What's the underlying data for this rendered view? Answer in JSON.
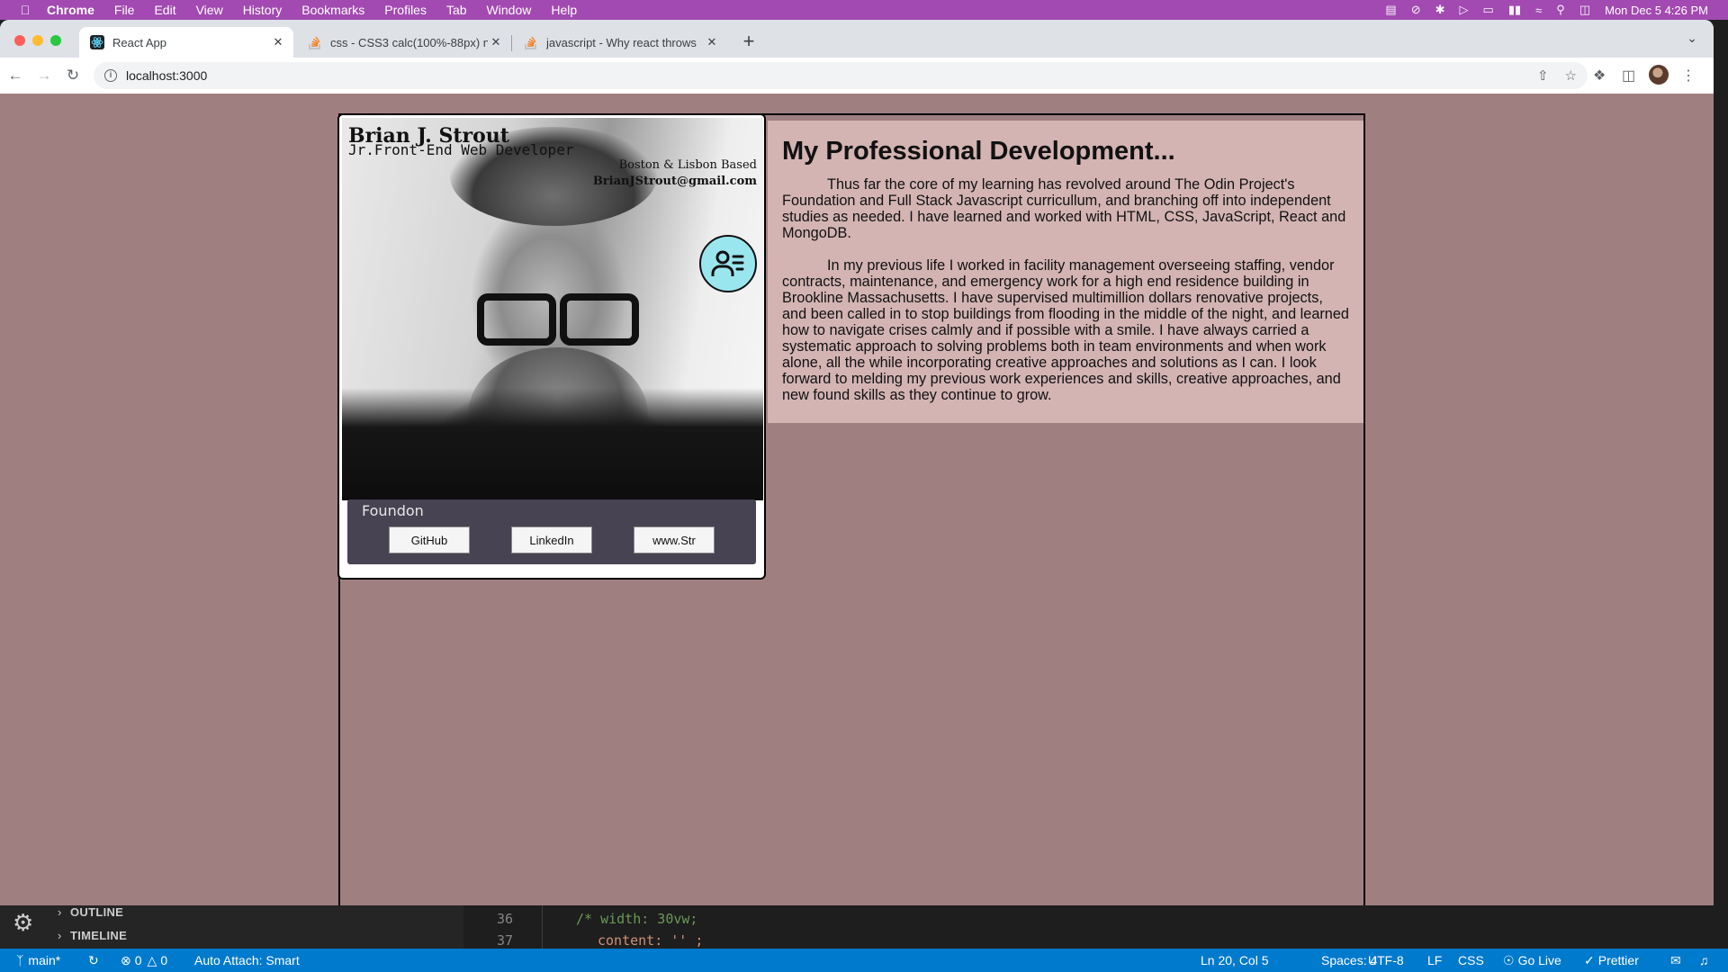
{
  "menubar": {
    "app": "Chrome",
    "items": [
      "File",
      "Edit",
      "View",
      "History",
      "Bookmarks",
      "Profiles",
      "Tab",
      "Window",
      "Help"
    ],
    "datetime": "Mon Dec 5  4:26 PM"
  },
  "browser": {
    "tabs": [
      {
        "title": "React App",
        "icon": "react-icon"
      },
      {
        "title": "css - CSS3 calc(100%-88px) n",
        "icon": "stackoverflow-icon"
      },
      {
        "title": "javascript - Why react throws ",
        "icon": "stackoverflow-icon"
      }
    ],
    "url": "localhost:3000"
  },
  "card": {
    "name": "Brian J. Strout",
    "role": "Jr.Front-End Web Developer",
    "location": "Boston & Lisbon Based",
    "email": "BrianJStrout@gmail.com",
    "contact_icon": "contact-card-icon",
    "foundon_label": "Foundon",
    "links": [
      "GitHub",
      "LinkedIn",
      "www.Str"
    ]
  },
  "about": {
    "heading": "My Professional Development...",
    "paragraphs": [
      "Thus far the core of my learning has revolved around The Odin Project's Foundation and Full Stack Javascript curricullum, and branching off into independent studies as needed. I have learned and worked with HTML, CSS, JavaScript, React and MongoDB.",
      "In my previous life I worked in facility management overseeing staffing, vendor contracts, maintenance, and emergency work for a high end residence building in Brookline Massachusetts. I have supervised multimillion dollars renovative projects, and been called in to stop buildings from flooding in the middle of the night, and learned how to navigate crises calmly and if possible with a smile. I have always carried a systematic approach to solving problems both in team environments and when work alone, all the while incorporating creative approaches and solutions as I can. I look forward to melding my previous work experiences and skills, creative approaches, and new found skills as they continue to grow."
    ]
  },
  "vscode": {
    "sidebar": [
      "OUTLINE",
      "TIMELINE"
    ],
    "lines": [
      {
        "num": "36",
        "code": "/* width: 30vw;"
      },
      {
        "num": "37",
        "code": "content: '' ;"
      }
    ],
    "status": {
      "branch": "main*",
      "errors": "0",
      "warnings": "0",
      "auto_attach": "Auto Attach: Smart",
      "position": "Ln 20, Col 5",
      "spaces": "Spaces: 4",
      "encoding": "UTF-8",
      "eol": "LF",
      "language": "CSS",
      "golive": "Go Live",
      "prettier": "Prettier"
    }
  },
  "colors": {
    "menubar": "#a24ab1",
    "page_bg": "#a07f81",
    "about_bg": "#d3b4b3",
    "foundon_bg": "#474352",
    "contact_btn": "#9ae6ee",
    "statusbar": "#007acc"
  }
}
